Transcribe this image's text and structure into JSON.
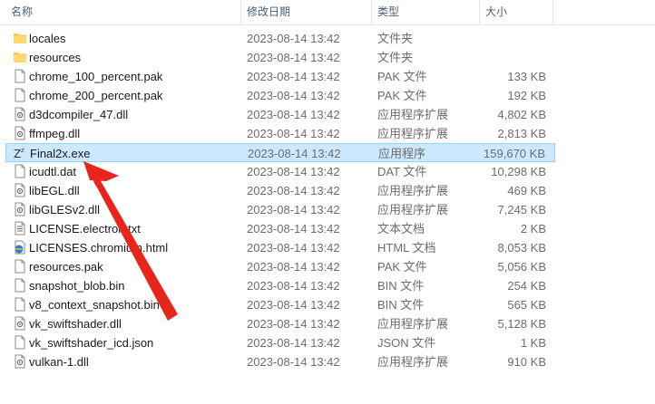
{
  "header": {
    "name": "名称",
    "date": "修改日期",
    "type": "类型",
    "size": "大小",
    "sort_icon": "chevron-up-icon"
  },
  "files": [
    {
      "name": "locales",
      "date": "2023-08-14 13:42",
      "type": "文件夹",
      "size": "",
      "icon": "folder"
    },
    {
      "name": "resources",
      "date": "2023-08-14 13:42",
      "type": "文件夹",
      "size": "",
      "icon": "folder"
    },
    {
      "name": "chrome_100_percent.pak",
      "date": "2023-08-14 13:42",
      "type": "PAK 文件",
      "size": "133 KB",
      "icon": "file"
    },
    {
      "name": "chrome_200_percent.pak",
      "date": "2023-08-14 13:42",
      "type": "PAK 文件",
      "size": "192 KB",
      "icon": "file"
    },
    {
      "name": "d3dcompiler_47.dll",
      "date": "2023-08-14 13:42",
      "type": "应用程序扩展",
      "size": "4,802 KB",
      "icon": "dll"
    },
    {
      "name": "ffmpeg.dll",
      "date": "2023-08-14 13:42",
      "type": "应用程序扩展",
      "size": "2,813 KB",
      "icon": "dll"
    },
    {
      "name": "Final2x.exe",
      "date": "2023-08-14 13:42",
      "type": "应用程序",
      "size": "159,670 KB",
      "icon": "exe",
      "selected": true
    },
    {
      "name": "icudtl.dat",
      "date": "2023-08-14 13:42",
      "type": "DAT 文件",
      "size": "10,298 KB",
      "icon": "file"
    },
    {
      "name": "libEGL.dll",
      "date": "2023-08-14 13:42",
      "type": "应用程序扩展",
      "size": "469 KB",
      "icon": "dll"
    },
    {
      "name": "libGLESv2.dll",
      "date": "2023-08-14 13:42",
      "type": "应用程序扩展",
      "size": "7,245 KB",
      "icon": "dll"
    },
    {
      "name": "LICENSE.electron.txt",
      "date": "2023-08-14 13:42",
      "type": "文本文档",
      "size": "2 KB",
      "icon": "text"
    },
    {
      "name": "LICENSES.chromium.html",
      "date": "2023-08-14 13:42",
      "type": "HTML 文档",
      "size": "8,053 KB",
      "icon": "html"
    },
    {
      "name": "resources.pak",
      "date": "2023-08-14 13:42",
      "type": "PAK 文件",
      "size": "5,056 KB",
      "icon": "file"
    },
    {
      "name": "snapshot_blob.bin",
      "date": "2023-08-14 13:42",
      "type": "BIN 文件",
      "size": "254 KB",
      "icon": "file"
    },
    {
      "name": "v8_context_snapshot.bin",
      "date": "2023-08-14 13:42",
      "type": "BIN 文件",
      "size": "565 KB",
      "icon": "file"
    },
    {
      "name": "vk_swiftshader.dll",
      "date": "2023-08-14 13:42",
      "type": "应用程序扩展",
      "size": "5,128 KB",
      "icon": "dll"
    },
    {
      "name": "vk_swiftshader_icd.json",
      "date": "2023-08-14 13:42",
      "type": "JSON 文件",
      "size": "1 KB",
      "icon": "file"
    },
    {
      "name": "vulkan-1.dll",
      "date": "2023-08-14 13:42",
      "type": "应用程序扩展",
      "size": "910 KB",
      "icon": "dll"
    }
  ],
  "annotation": {
    "icon": "red-arrow-icon",
    "color": "#e8251a"
  }
}
